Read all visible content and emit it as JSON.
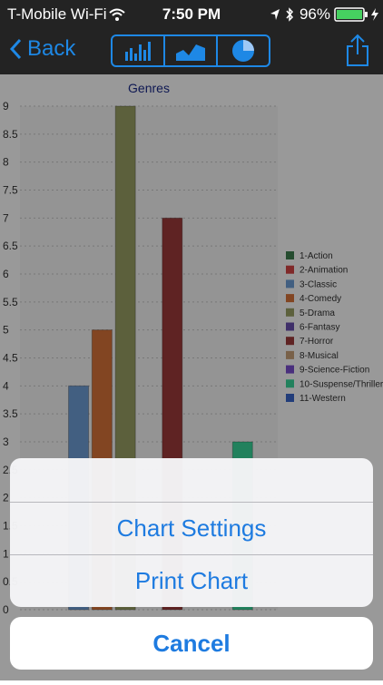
{
  "status_bar": {
    "carrier": "T-Mobile Wi-Fi",
    "time": "7:50 PM",
    "battery": "96%"
  },
  "nav": {
    "back_label": "Back",
    "segments": [
      "bar-chart-icon",
      "area-chart-icon",
      "pie-chart-icon"
    ],
    "share_icon": "share-icon"
  },
  "action_sheet": {
    "options": [
      "Chart Settings",
      "Print Chart"
    ],
    "cancel_label": "Cancel"
  },
  "chart_data": {
    "type": "bar",
    "title": "Genres",
    "xlabel": "",
    "ylabel": "",
    "ylim": [
      0,
      9
    ],
    "yticks": [
      "0",
      "0.5",
      "1",
      "1.5",
      "2",
      "2.5",
      "3",
      "3.5",
      "4",
      "4.5",
      "5",
      "5.5",
      "6",
      "6.5",
      "7",
      "7.5",
      "8",
      "8.5",
      "9"
    ],
    "legend_position": "right",
    "categories": [
      "1-Action",
      "2-Animation",
      "3-Classic",
      "4-Comedy",
      "5-Drama",
      "6-Fantasy",
      "7-Horror",
      "8-Musical",
      "9-Science-Fiction",
      "10-Suspense/Thriller",
      "11-Western"
    ],
    "values": [
      0,
      0,
      4,
      5,
      9,
      0,
      7,
      0,
      0,
      3,
      0
    ],
    "colors": [
      "#3f7f4f",
      "#d64545",
      "#6f9fd8",
      "#d9743a",
      "#9aa065",
      "#6a4fb0",
      "#9e3b3b",
      "#caa27a",
      "#7a4fd1",
      "#3ad89b",
      "#3a66cc"
    ]
  }
}
